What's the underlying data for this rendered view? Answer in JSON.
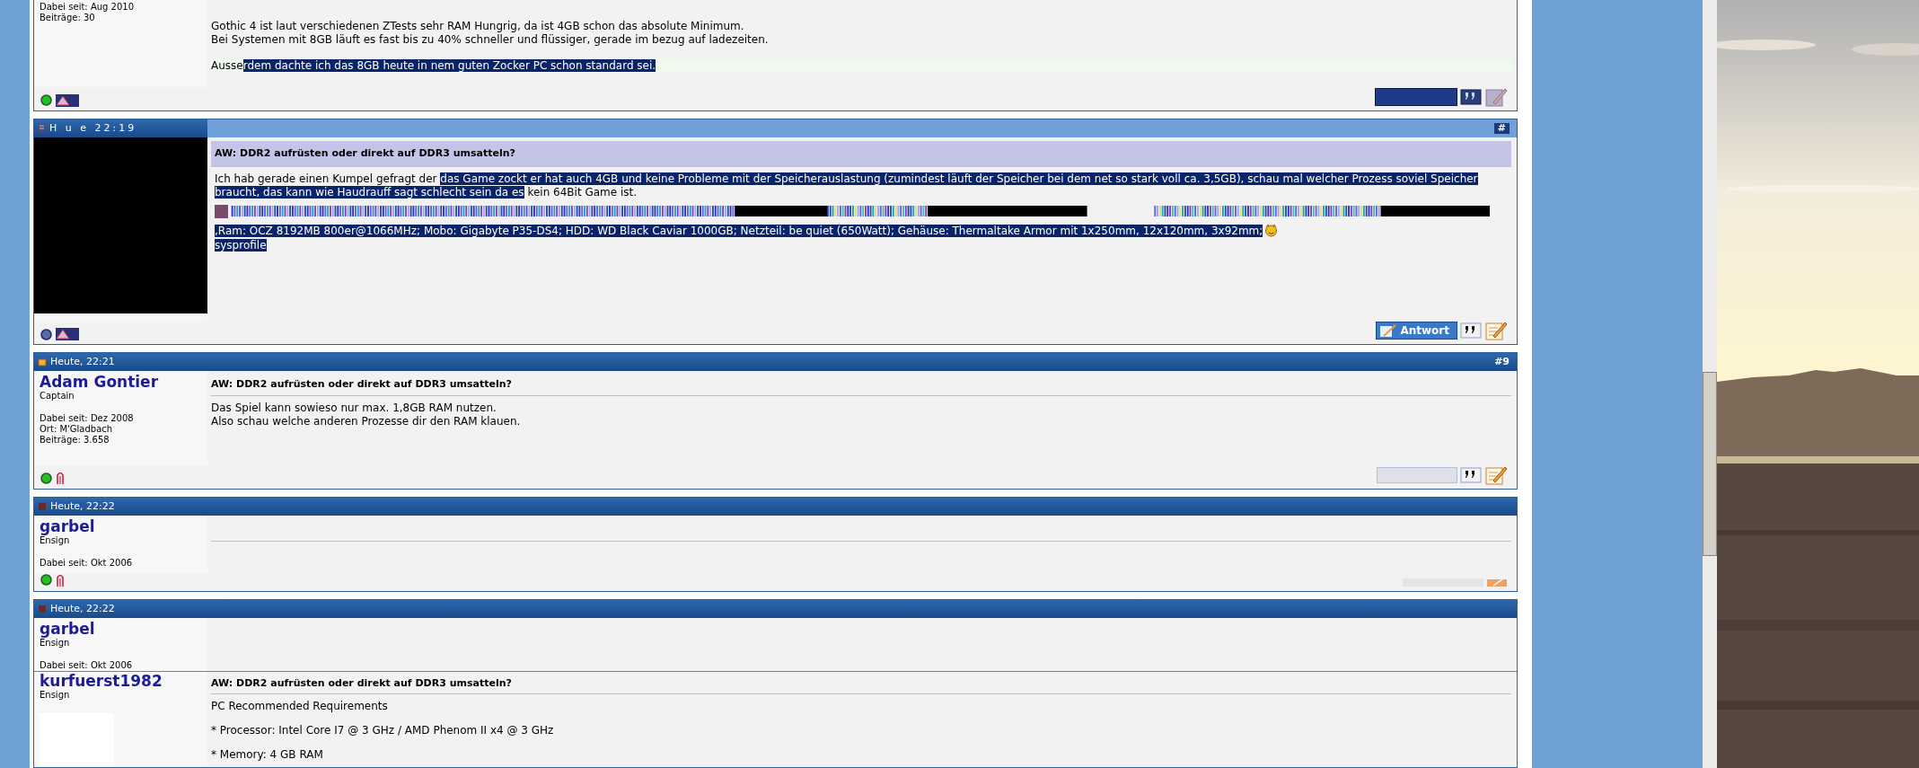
{
  "posts": [
    {
      "kind": "partial",
      "user": {
        "meta": [
          "Dabei seit: Aug 2010",
          "Beiträge: 30"
        ]
      },
      "paragraphs": [
        [
          {
            "text": "Gothic 4 ist laut verschiedenen ZTests sehr RAM Hungrig, da ist 4GB schon das absolute Minimum.",
            "selected": false
          }
        ],
        [
          {
            "text": "Bei Systemen mit 8GB läuft es fast bis zu 40% schneller und flüssiger, gerade im bezug auf ladezeiten.",
            "selected": false
          }
        ],
        [
          {
            "text": "Ausse",
            "selected": false
          },
          {
            "text": "rdem dachte ich das 8GB heute in nem guten Zocker PC schon standard sei.",
            "selected": true
          }
        ]
      ],
      "footer": {
        "left": [
          {
            "kind": "online"
          },
          {
            "kind": "warning-dark"
          }
        ],
        "right": [
          {
            "kind": "bar"
          },
          {
            "kind": "quote-dark"
          },
          {
            "kind": "edit-faded"
          }
        ]
      }
    },
    {
      "kind": "glitched",
      "header": {
        "time": "H u e 22:19",
        "number": "#"
      },
      "title": "AW: DDR2 aufrüsten oder direkt auf DDR3 umsatteln?",
      "paragraphs": [
        [
          {
            "text": "Ich hab gerade einen Kumpel gefragt der ",
            "selected": false
          },
          {
            "text": "das Game zockt er hat auch 4GB und keine Probleme mit der Speicherauslastung (zumindest läuft der Speicher bei dem net so stark voll ca. 3,5GB), schau mal welcher Prozess soviel Speicher braucht, das kann wie Haudrauff sagt schlecht sein da es",
            "selected": true
          },
          {
            "text": " kein 64Bit Game ist.",
            "selected": false
          }
        ]
      ],
      "signature": {
        "specs": ",Ram: OCZ 8192MB 800er@1066MHz; Mobo: Gigabyte P35-DS4; HDD: WD Black Caviar 1000GB; Netzteil: be quiet (650Watt); Gehäuse: Thermaltake Armor mit 1x250mm, 12x120mm, 3x92mm;",
        "link": "sysprofile"
      },
      "footer": {
        "left": [
          {
            "kind": "offline"
          },
          {
            "kind": "warning-dark"
          }
        ],
        "right": [
          {
            "kind": "reply"
          },
          {
            "kind": "quote"
          },
          {
            "kind": "edit"
          }
        ]
      },
      "reply_label": "Antwort"
    },
    {
      "kind": "normal",
      "header": {
        "time": "Heute, 22:21",
        "number": "#9"
      },
      "user": {
        "name": "Adam Gontier",
        "rank": "Captain",
        "meta": [
          "Dabei seit: Dez 2008",
          "Ort: M'Gladbach",
          "Beiträge: 3.658"
        ]
      },
      "title": "AW: DDR2 aufrüsten oder direkt auf DDR3 umsatteln?",
      "paragraphs": [
        [
          {
            "text": "Das Spiel kann sowieso nur max. 1,8GB RAM nutzen.",
            "selected": false
          }
        ],
        [
          {
            "text": "Also schau welche anderen Prozesse dir den RAM klauen.",
            "selected": false
          }
        ]
      ],
      "footer": {
        "left": [
          {
            "kind": "online"
          },
          {
            "kind": "pm"
          }
        ],
        "right": [
          {
            "kind": "reply-faded"
          },
          {
            "kind": "quote"
          },
          {
            "kind": "edit"
          }
        ]
      }
    },
    {
      "kind": "empty",
      "header": {
        "time": "Heute, 22:22"
      },
      "user": {
        "name": "garbel",
        "rank": "Ensign",
        "meta": [
          "Dabei seit: Okt 2006"
        ]
      },
      "footer": {
        "left": [
          {
            "kind": "online"
          },
          {
            "kind": "pm"
          }
        ],
        "right": [
          {
            "kind": "bar-faded"
          },
          {
            "kind": "edit-small"
          }
        ]
      }
    },
    {
      "kind": "overlap",
      "header": {
        "time": "Heute, 22:22"
      },
      "user": {
        "name": "garbel",
        "rank": "Ensign",
        "meta": [
          "Dabei seit: Okt 2006"
        ]
      },
      "second_user": {
        "name": "kurfuerst1982",
        "rank": "Ensign"
      },
      "title": "AW: DDR2 aufrüsten oder direkt auf DDR3 umsatteln?",
      "paragraphs": [
        [
          {
            "text": "PC Recommended Requirements",
            "selected": false
          }
        ],
        [
          {
            "text": "* Processor: Intel Core I7 @ 3 GHz / AMD Phenom II x4 @ 3 GHz",
            "selected": false
          }
        ],
        [
          {
            "text": "* Memory: 4 GB RAM",
            "selected": false
          }
        ]
      ]
    }
  ]
}
